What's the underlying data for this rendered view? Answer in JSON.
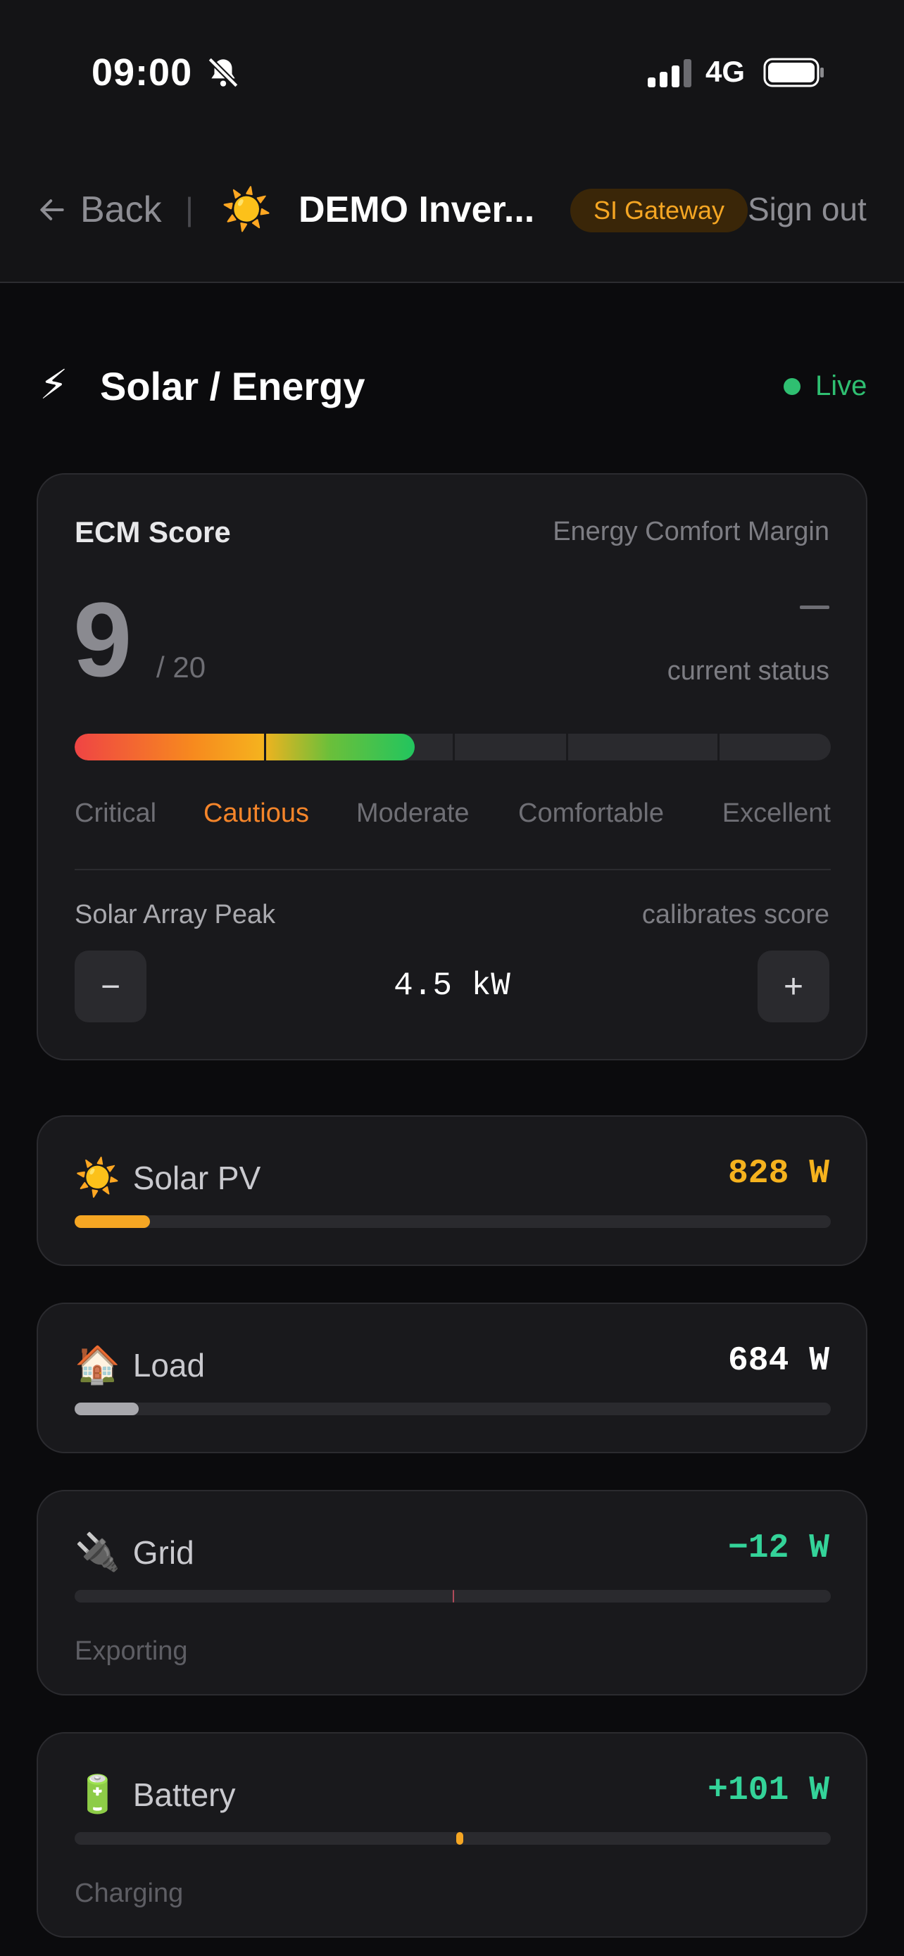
{
  "status_bar": {
    "time": "09:00",
    "network": "4G",
    "icons": [
      "bell-slash-icon",
      "signal-bars-icon",
      "battery-icon"
    ]
  },
  "header": {
    "back_label": "Back",
    "separator": "|",
    "site_emoji": "☀️",
    "site_name": "DEMO Inver...",
    "badge": "SI Gateway",
    "signout_label": "Sign out"
  },
  "section": {
    "emoji": "⚡",
    "title": "Solar / Energy",
    "live_label": "Live",
    "live_color": "#2fbf71"
  },
  "ecm": {
    "title": "ECM Score",
    "subtitle": "Energy Comfort Margin",
    "score": "9",
    "max": "/ 20",
    "status_value": "–",
    "status_label": "current status",
    "fill_fraction": 0.45,
    "segment_boundaries": [
      0.25,
      0.5,
      0.65,
      0.85
    ],
    "levels": [
      "Critical",
      "Cautious",
      "Moderate",
      "Comfortable",
      "Excellent"
    ],
    "active_level": "Cautious",
    "peak_label": "Solar Array Peak",
    "peak_hint": "calibrates score",
    "peak_value": "4.5 kW",
    "minus_label": "−",
    "plus_label": "+"
  },
  "metrics": {
    "solar": {
      "emoji": "☀️",
      "label": "Solar PV",
      "value": "828 W",
      "color": "#f5b21e",
      "fill_color": "#f5a623",
      "fill_fraction": 0.1
    },
    "load": {
      "emoji": "🏠",
      "label": "Load",
      "value": "684 W",
      "color": "#ffffff",
      "fill_color": "#a8a8ad",
      "fill_fraction": 0.085
    },
    "grid": {
      "emoji": "🔌",
      "label": "Grid",
      "value": "−12 W",
      "color": "#34d399",
      "marker_color": "#b04a5a",
      "marker_position": 0.5,
      "status": "Exporting"
    },
    "battery": {
      "emoji": "🔋",
      "label": "Battery",
      "value": "+101 W",
      "color": "#34d399",
      "marker_color": "#f5a623",
      "marker_position": 0.505,
      "status": "Charging"
    }
  }
}
